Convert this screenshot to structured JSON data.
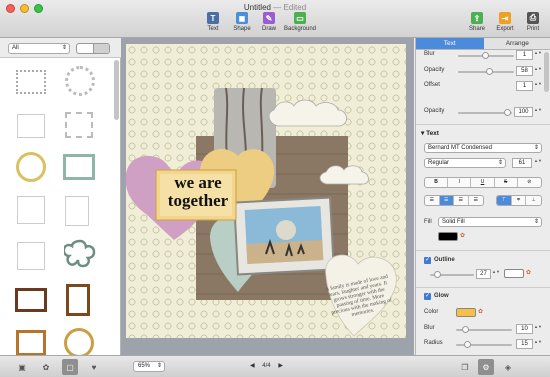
{
  "window": {
    "title": "Untitled",
    "subtitle": "Edited",
    "traffic_lights": [
      "#fc5f57",
      "#fdbc2e",
      "#33c748"
    ]
  },
  "toolbar": {
    "center": [
      {
        "label": "Text",
        "icon": "text-icon",
        "color": "#4a6fa0",
        "glyph": "T"
      },
      {
        "label": "Shape",
        "icon": "shape-icon",
        "color": "#4a8fd8",
        "glyph": "◼"
      },
      {
        "label": "Draw",
        "icon": "draw-icon",
        "color": "#9b5bd2",
        "glyph": "✎"
      },
      {
        "label": "Background",
        "icon": "background-icon",
        "color": "#4caf50",
        "glyph": "▭"
      }
    ],
    "right": [
      {
        "label": "Share",
        "icon": "share-icon",
        "color": "#4caf50",
        "glyph": "⇪"
      },
      {
        "label": "Export",
        "icon": "export-icon",
        "color": "#f0a020",
        "glyph": "⇥"
      },
      {
        "label": "Print",
        "icon": "print-icon",
        "color": "#555555",
        "glyph": "⎙"
      }
    ]
  },
  "left_panel": {
    "filter_value": "All"
  },
  "canvas": {
    "headline_line1": "we are",
    "headline_line2": "together",
    "quote_text": "A family is made of love and tears, laughter and years. It grows stronger with the passing of time. More precious with the making of memories."
  },
  "inspector": {
    "tabs": [
      "Text",
      "Arrange"
    ],
    "active_tab": "Text",
    "blur_label": "Blur",
    "blur_value": "1",
    "opacity_label": "Opacity",
    "opacity_value": "58",
    "offset_label": "Offset",
    "offset_value": "1",
    "opacity2_label": "Opacity",
    "opacity2_value": "100",
    "text_section": "Text",
    "font_family": "Bernard MT Condensed",
    "font_style": "Regular",
    "font_size": "61",
    "style_buttons": [
      "B",
      "I",
      "U",
      "S",
      "⊘"
    ],
    "fill_label": "Fill",
    "fill_value": "Solid Fill",
    "fill_color": "#000000",
    "outline_label": "Outline",
    "outline_value": "27",
    "outline_color": "#ffffff",
    "glow_label": "Glow",
    "glow_color_label": "Color",
    "glow_color": "#f5c048",
    "glow_blur_label": "Blur",
    "glow_blur_value": "10",
    "glow_radius_label": "Radius",
    "glow_radius_value": "15"
  },
  "bottom": {
    "zoom": "65%",
    "page": "4/4"
  }
}
